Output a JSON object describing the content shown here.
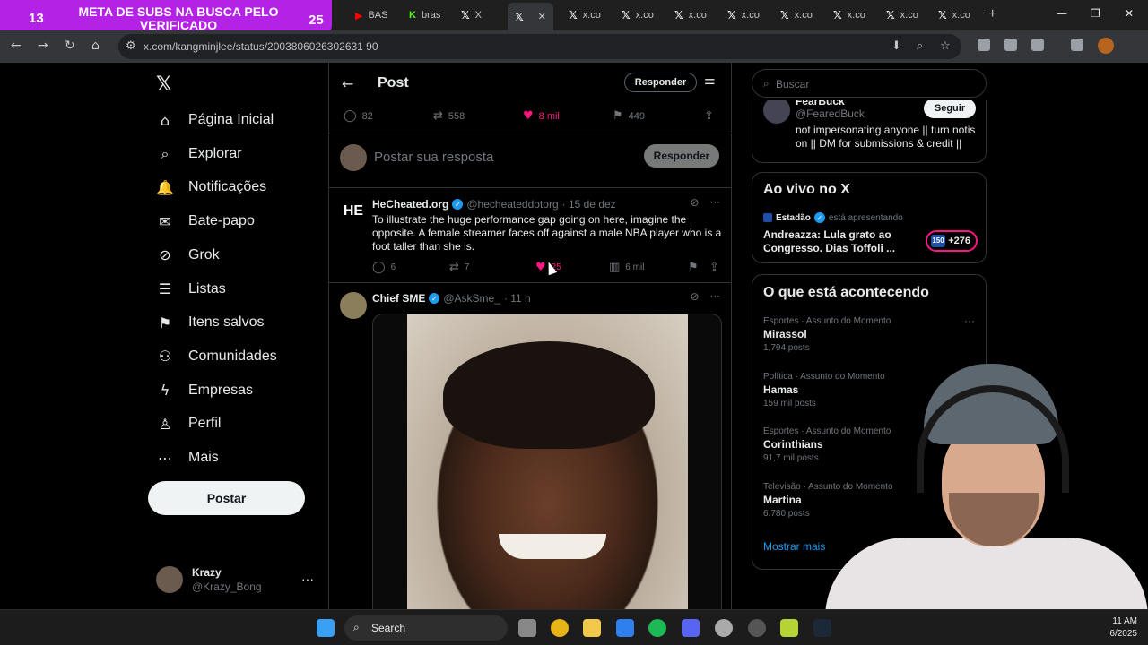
{
  "overlay": {
    "left_count": "13",
    "headline": "META DE SUBS NA BUSCA PELO VERIFICADO",
    "right_count": "25"
  },
  "browser": {
    "tabs": [
      "BAS",
      "bras",
      "X",
      "x.co",
      "x.co",
      "x.co",
      "x.co",
      "x.co",
      "x.co",
      "x.co",
      "x.co"
    ],
    "url": "x.com/kangminjlee/status/2003806026302631 90"
  },
  "sidebar": {
    "items": [
      {
        "label": "Página Inicial",
        "icon": "home-icon"
      },
      {
        "label": "Explorar",
        "icon": "search-icon"
      },
      {
        "label": "Notificações",
        "icon": "bell-icon"
      },
      {
        "label": "Bate-papo",
        "icon": "mail-icon"
      },
      {
        "label": "Grok",
        "icon": "grok-icon"
      },
      {
        "label": "Listas",
        "icon": "list-icon"
      },
      {
        "label": "Itens salvos",
        "icon": "bookmark-icon"
      },
      {
        "label": "Comunidades",
        "icon": "communities-icon"
      },
      {
        "label": "Empresas",
        "icon": "lightning-icon"
      },
      {
        "label": "Perfil",
        "icon": "person-icon"
      },
      {
        "label": "Mais",
        "icon": "more-circle-icon"
      }
    ],
    "post_button": "Postar",
    "user": {
      "name": "Krazy",
      "handle": "@Krazy_Bong"
    }
  },
  "post_header": {
    "title": "Post",
    "reply_button": "Responder"
  },
  "main_stats": {
    "replies": "82",
    "reposts": "558",
    "likes": "8 mil",
    "bookmarks": "449"
  },
  "composer": {
    "placeholder": "Postar sua resposta",
    "button": "Responder"
  },
  "tweets": [
    {
      "name": "HeCheated.org",
      "handle": "@hecheateddotorg",
      "time": "· 15 de dez",
      "avatar_text": "HE",
      "text": "To illustrate the huge performance gap going on here, imagine the opposite. A female streamer faces off against a male NBA player who is a foot taller than she is.",
      "replies": "6",
      "reposts": "7",
      "likes": "25",
      "views": "6 mil"
    },
    {
      "name": "Chief SME",
      "handle": "@AskSme_",
      "time": "· 11 h"
    }
  ],
  "right": {
    "search_placeholder": "Buscar",
    "follow_card": {
      "name": "FearBuck",
      "handle": "@FearedBuck",
      "follow": "Seguir",
      "bio": "not impersonating anyone || turn notis on || DM for submissions & credit ||"
    },
    "live": {
      "title": "Ao vivo no X",
      "source": "Estadão",
      "presenting": "está apresentando",
      "headline": "Andreazza: Lula grato ao Congresso. Dias Toffoli ...",
      "badge_pic": "150",
      "badge": "+276"
    },
    "trends": {
      "title": "O que está acontecendo",
      "items": [
        {
          "category": "Esportes · Assunto do Momento",
          "name": "Mirassol",
          "count": "1,794 posts"
        },
        {
          "category": "Política · Assunto do Momento",
          "name": "Hamas",
          "count": "159 mil posts"
        },
        {
          "category": "Esportes · Assunto do Momento",
          "name": "Corinthians",
          "count": "91,7 mil posts"
        },
        {
          "category": "Televisão · Assunto do Momento",
          "name": "Martina",
          "count": "6.780 posts"
        }
      ],
      "more": "Mostrar mais"
    }
  },
  "taskbar": {
    "search": "Search",
    "time": "11 AM",
    "date": "6/2025"
  },
  "colors": {
    "accent": "#1d9bf0",
    "like": "#f91880",
    "banner": "#b422e5",
    "bg": "#000000"
  }
}
